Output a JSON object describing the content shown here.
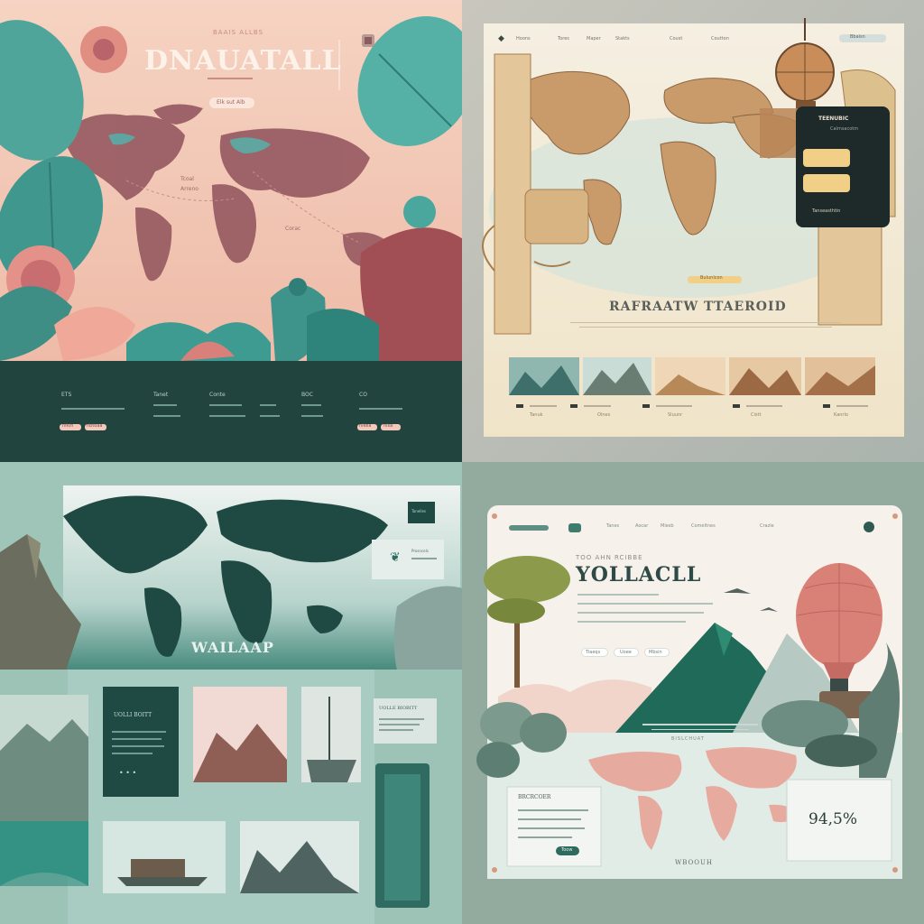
{
  "quadrants": {
    "pink": {
      "headline": "DNAUATALL",
      "kicker": "BAAIS ALLBS",
      "cta_label": "Elk sut Alb",
      "map_labels": [
        "Tcoal",
        "Arreno",
        "Corac"
      ],
      "footer_columns": [
        "ETS",
        "Tanet",
        "Conte",
        "BOC",
        "CO"
      ],
      "footer_buttons": [
        "nfkin",
        "nbtoaa",
        "nlkea",
        "nisa"
      ]
    },
    "parchment": {
      "headline": "RAFRAATW TTAEROID",
      "nav_items": [
        "Hoons",
        "Tores",
        "Maper",
        "Stakts",
        "Coust",
        "Coutton"
      ],
      "nav_button": "Bbaisn",
      "panel_title": "TEENUBIC",
      "panel_subtitle": "Calmsacotm",
      "panel_bottom_label": "Tanseasthtin",
      "cta_label": "Bulunlcon",
      "gallery_captions": [
        "Tanuk",
        "Olnes",
        "Sluunr",
        "Cistt",
        "Kanrlo"
      ]
    },
    "teal": {
      "headline": "WAILAAP",
      "corner_badge": "Tanelles",
      "side_card_title": "Prosncels",
      "dark_card_title": "UOLLI BOITT",
      "dark_card_dots": "• • •",
      "info_card_title": "UOLLE BIOBITT"
    },
    "sage": {
      "kicker": "TOO AHN RCIBBE",
      "headline": "YOLLACLL",
      "nav_items": [
        "Tanes",
        "Aocar",
        "Miesb",
        "Comeltnes",
        "Crazle"
      ],
      "buttons": [
        "Tiaeqs",
        "Uoee",
        "Mbsin"
      ],
      "left_card_title": "BRCRCOER",
      "left_card_button": "Toow",
      "map_caption": "BISLCHUAT",
      "stat_value": "94,5%",
      "footer_label": "WBOOUH"
    }
  },
  "colors": {
    "pink_bg": "#f3c9b6",
    "pink_footer": "#21443f",
    "teal_leaf": "#4fa59a",
    "rose_map": "#9a5e64",
    "parchment_bg": "#f4ebd8",
    "gold": "#f1cf86",
    "dark_panel": "#1e2a2a",
    "teal_map": "#1f4a43",
    "sage_card": "#f6f1ea",
    "balloon": "#d98177",
    "mountain": "#1f6a58"
  }
}
